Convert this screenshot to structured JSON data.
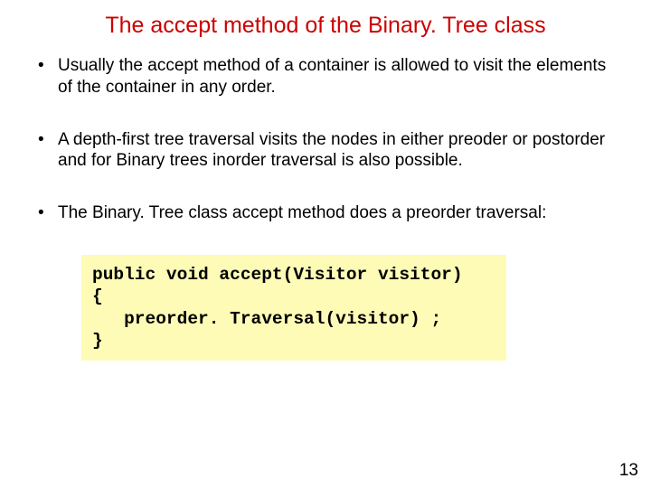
{
  "title": "The accept method of the Binary. Tree class",
  "bullets": [
    "Usually the accept method of a container is allowed to visit the elements of the container in any order.",
    "A depth-first tree traversal visits the nodes in either preoder or postorder and for Binary trees inorder traversal is also possible.",
    "The Binary. Tree class accept method does a preorder traversal:"
  ],
  "code_lines": [
    "public void accept(Visitor visitor)",
    "{",
    "   preorder. Traversal(visitor) ;",
    "}"
  ],
  "page_number": "13",
  "bullet_char": "•"
}
